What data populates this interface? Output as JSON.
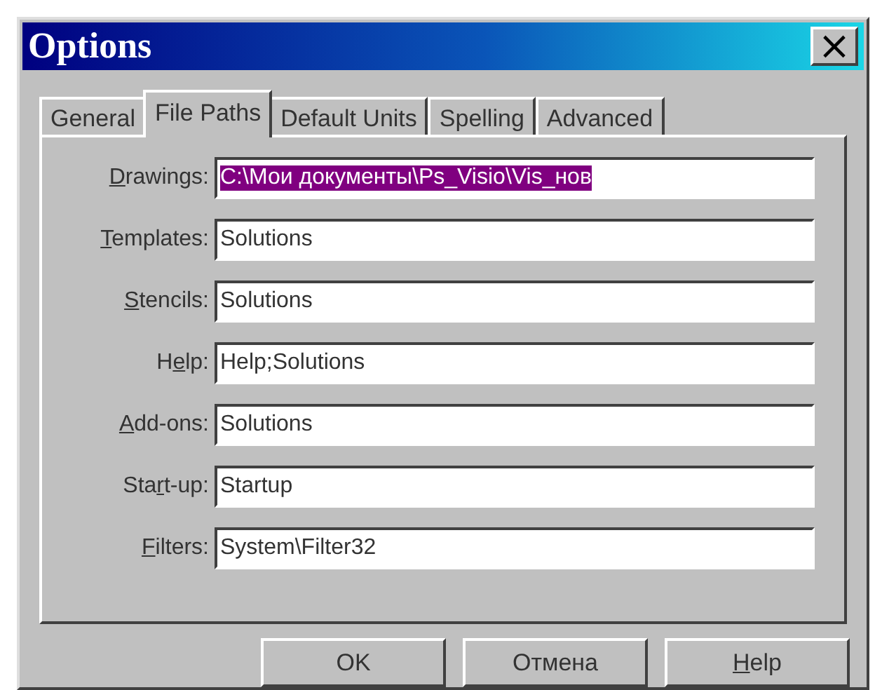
{
  "window": {
    "title": "Options",
    "close": "×"
  },
  "tabs": [
    {
      "label": "General",
      "selected": false
    },
    {
      "label": "File Paths",
      "selected": true
    },
    {
      "label": "Default Units",
      "selected": false
    },
    {
      "label": "Spelling",
      "selected": false
    },
    {
      "label": "Advanced",
      "selected": false
    }
  ],
  "fields": [
    {
      "label": {
        "underlined": "D",
        "after": "rawings:"
      },
      "value": "C:\\Мои документы\\Ps_Visio\\Vis_нов",
      "selected": true
    },
    {
      "label": {
        "underlined": "T",
        "after": "emplates:"
      },
      "value": "Solutions",
      "selected": false
    },
    {
      "label": {
        "underlined": "S",
        "after": "tencils:"
      },
      "value": "Solutions",
      "selected": false
    },
    {
      "label": {
        "before": "H",
        "underlined": "e",
        "after": "lp:"
      },
      "value": "Help;Solutions",
      "selected": false
    },
    {
      "label": {
        "underlined": "A",
        "after": "dd-ons:"
      },
      "value": "Solutions",
      "selected": false
    },
    {
      "label": {
        "before": "Sta",
        "underlined": "r",
        "after": "t-up:"
      },
      "value": "Startup",
      "selected": false
    },
    {
      "label": {
        "underlined": "F",
        "after": "ilters:"
      },
      "value": "System\\Filter32",
      "selected": false
    }
  ],
  "buttons": [
    {
      "label": {
        "before": "OK"
      }
    },
    {
      "label": {
        "before": "Отмена"
      }
    },
    {
      "label": {
        "underlined": "H",
        "after": "elp"
      }
    }
  ]
}
